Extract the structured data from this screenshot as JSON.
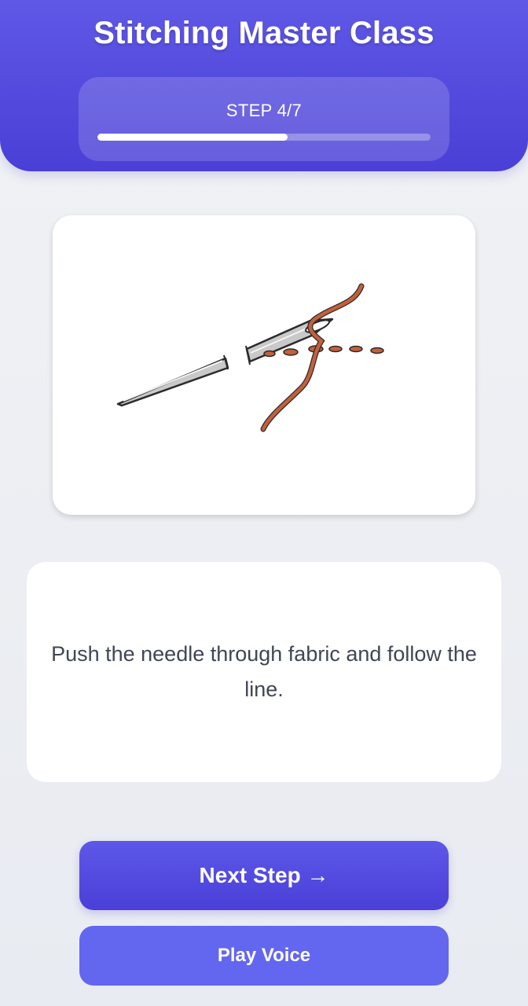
{
  "header": {
    "title": "Stitching Master Class",
    "step_label": "STEP 4/7",
    "progress": 0.571
  },
  "illustration": {
    "subject": "needle-and-thread-sketch",
    "colors": {
      "thread": "#c4603c",
      "needle": "#9e9e9e"
    }
  },
  "instruction": {
    "text": "Push the needle through fabric and follow the line."
  },
  "actions": {
    "next_label": "Next Step →",
    "voice_label": "Play Voice"
  },
  "theme": {
    "primary": "#4f46e5",
    "secondary": "#6366ef",
    "background": "#eef0f4"
  }
}
